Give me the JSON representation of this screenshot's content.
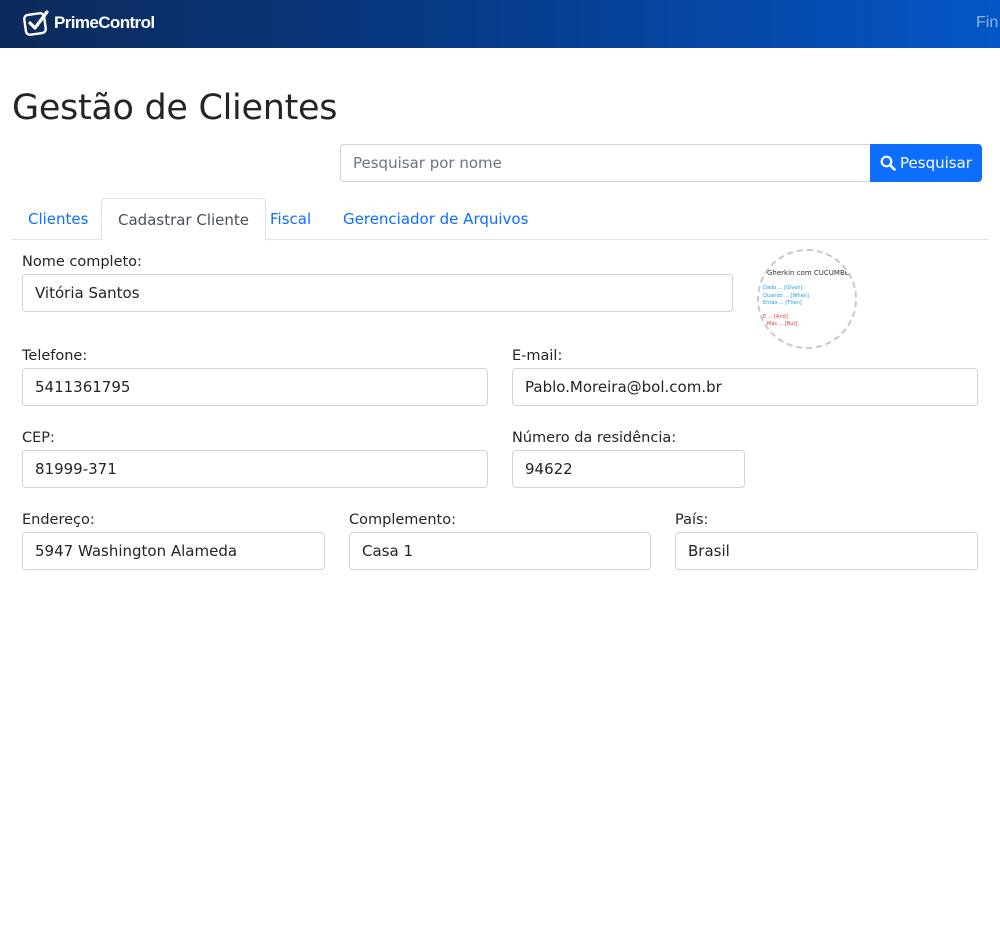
{
  "navbar": {
    "brand_name": "PrimeControl",
    "right_link": "Fin"
  },
  "page": {
    "title": "Gestão de Clientes"
  },
  "search": {
    "placeholder": "Pesquisar por nome",
    "value": "",
    "button_label": "Pesquisar"
  },
  "tabs": [
    {
      "label": "Clientes",
      "active": false
    },
    {
      "label": "Cadastrar Cliente",
      "active": true
    },
    {
      "label": "Fiscal",
      "active": false
    },
    {
      "label": "Gerenciador de Arquivos",
      "active": false
    }
  ],
  "form": {
    "nome": {
      "label": "Nome completo:",
      "value": "Vitória Santos"
    },
    "telefone": {
      "label": "Telefone:",
      "value": "5411361795"
    },
    "email": {
      "label": "E-mail:",
      "value": "Pablo.Moreira@bol.com.br"
    },
    "cep": {
      "label": "CEP:",
      "value": "81999-371"
    },
    "numero": {
      "label": "Número da residência:",
      "value": "94622"
    },
    "endereco": {
      "label": "Endereço:",
      "value": "5947 Washington Alameda"
    },
    "complemento": {
      "label": "Complemento:",
      "value": "Casa 1"
    },
    "pais": {
      "label": "País:",
      "value": "Brasil"
    }
  },
  "avatar": {
    "title": "Gherkin com CUCUMBER",
    "lines": [
      {
        "text": "Dado ... [Given]",
        "color": "#1a9be6"
      },
      {
        "text": "Quando ... [When]",
        "color": "#1a9be6"
      },
      {
        "text": "Então ... [Then]",
        "color": "#1a9be6"
      },
      {
        "text": "E ... [And]",
        "color": "#e53935"
      },
      {
        "text": "Mas ... [But]",
        "color": "#e53935"
      }
    ]
  },
  "colors": {
    "primary": "#0d6efd",
    "navbar_start": "#0c2a5a",
    "navbar_end": "#0456c6"
  }
}
